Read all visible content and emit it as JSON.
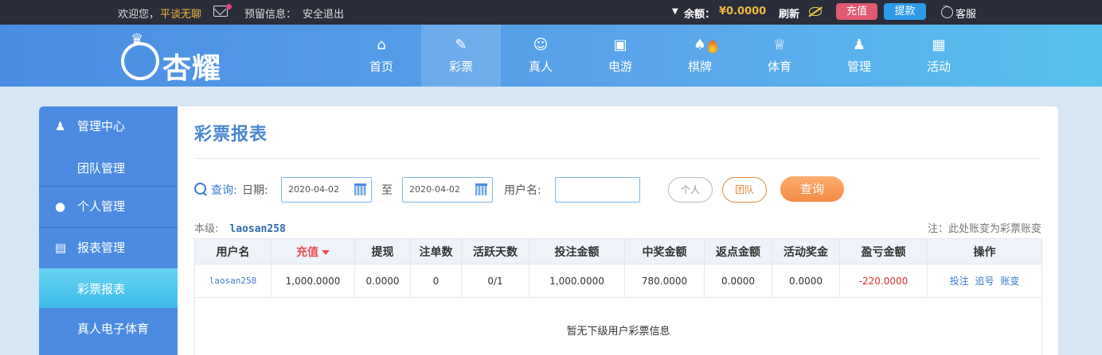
{
  "topbar": {
    "welcome": "欢迎您，",
    "username": "平谈无聊",
    "reserved_label": "预留信息：",
    "logout": "安全退出",
    "balance_label": "余额：",
    "balance_value": "¥0.0000",
    "refresh": "刷新",
    "charge": "充值",
    "withdraw": "提款",
    "service": "客服"
  },
  "logo": {
    "text": "杏耀"
  },
  "nav": {
    "items": [
      {
        "label": "首页",
        "icon": "home-icon"
      },
      {
        "label": "彩票",
        "icon": "ticket-icon",
        "active": true
      },
      {
        "label": "真人",
        "icon": "person-icon"
      },
      {
        "label": "电游",
        "icon": "game-icon"
      },
      {
        "label": "棋牌",
        "icon": "cards-icon",
        "hot": true
      },
      {
        "label": "体育",
        "icon": "trophy-icon"
      },
      {
        "label": "管理",
        "icon": "team-icon"
      },
      {
        "label": "活动",
        "icon": "gift-icon"
      }
    ]
  },
  "sidebar": {
    "items": [
      {
        "label": "管理中心",
        "icon": "users-icon"
      },
      {
        "label": "团队管理"
      },
      {
        "label": "个人管理",
        "icon": "user-icon"
      },
      {
        "label": "报表管理",
        "icon": "report-icon"
      },
      {
        "label": "彩票报表",
        "active": true
      },
      {
        "label": "真人电子体育"
      }
    ]
  },
  "main": {
    "title": "彩票报表",
    "query_label": "查询:",
    "date_label": "日期:",
    "date_from": "2020-04-02",
    "to_label": "至",
    "date_to": "2020-04-02",
    "username_label": "用户名:",
    "username_value": "",
    "personal": "个人",
    "team": "团队",
    "search": "查询",
    "level_label": "本级:",
    "level_user": "laosan258",
    "note": "注：此处账变为彩票账变"
  },
  "table": {
    "headers": [
      "用户名",
      "充值",
      "提现",
      "注单数",
      "活跃天数",
      "投注金额",
      "中奖金额",
      "返点金额",
      "活动奖金",
      "盈亏金额",
      "操作"
    ],
    "rows": [
      {
        "username": "laosan258",
        "charge": "1,000.0000",
        "withdraw": "0.0000",
        "orders": "0",
        "active_days": "0/1",
        "bet": "1,000.0000",
        "win": "780.0000",
        "rebate": "0.0000",
        "bonus": "0.0000",
        "profit": "-220.0000",
        "ops": [
          "投注",
          "追号",
          "账变"
        ]
      }
    ],
    "empty_text": "暂无下级用户彩票信息"
  },
  "colors": {
    "topbar": "#2a2d3a",
    "nav_start": "#4a8de3",
    "nav_end": "#56c3ee",
    "accent_gold": "#f0b640",
    "charge": "#e05a72",
    "withdraw": "#2f9be8",
    "loss": "#d93030",
    "search_button": "#f48b45"
  }
}
